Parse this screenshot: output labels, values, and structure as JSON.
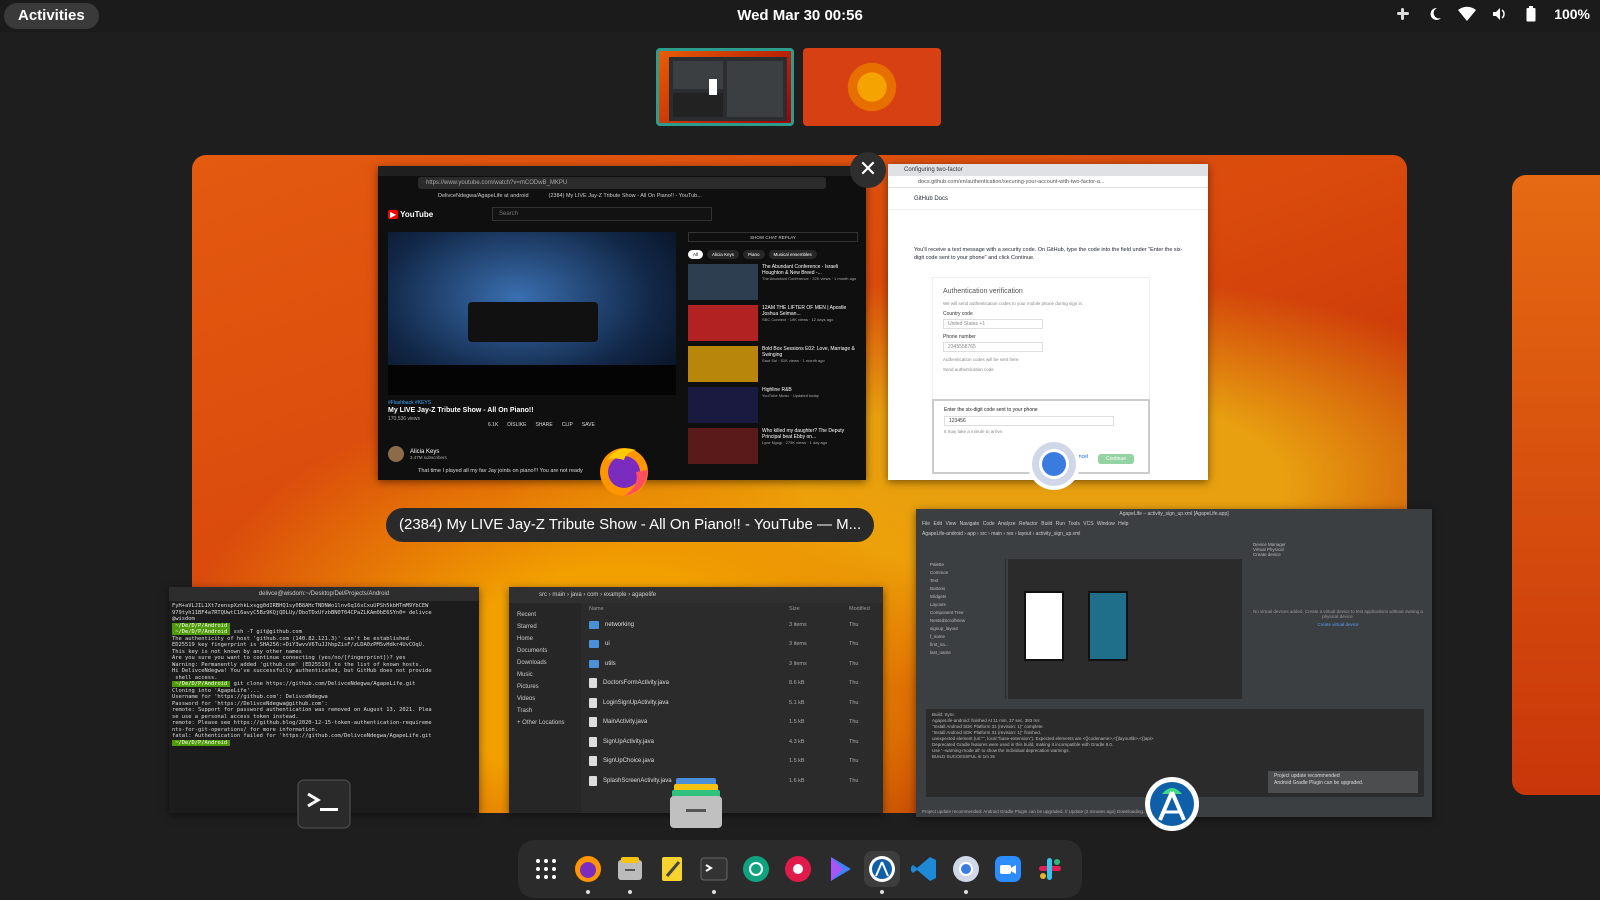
{
  "topbar": {
    "activities": "Activities",
    "clock": "Wed Mar 30  00:56",
    "battery": "100%"
  },
  "overview": {
    "focused_window_title": "(2384) My LIVE Jay-Z Tribute Show - All On Piano!! - YouTube — M...",
    "close_symbol": "✕"
  },
  "youtube": {
    "url": "https://www.youtube.com/watch?v=mCODwB_MKPU",
    "tab1": "DelivceNdegwa/AgapeLife at android",
    "tab2": "(2384) My LIVE Jay-Z Tribute Show - All On Piano!! - YouTub...",
    "logo": "YouTube",
    "search_placeholder": "Search",
    "hashtags": "#Flashback #KEYS",
    "video_title": "My LIVE Jay-Z Tribute Show - All On Piano!!",
    "views": "170,536 views",
    "actions": [
      "6.1K",
      "DISLIKE",
      "SHARE",
      "CLIP",
      "SAVE"
    ],
    "channel": "Alicia Keys",
    "subscribers": "3.47M subscribers",
    "description": "That time I played all my fav Jay joints on piano!!! You are not ready",
    "live_chat": "SHOW CHAT REPLAY",
    "chips": [
      "All",
      "Alicia Keys",
      "Piano",
      "Musical ensembles"
    ],
    "recs": [
      {
        "title": "The Abundant Conference - Israeli Houghton & New Breed -...",
        "sub": "The Abundant Conference · 22K views · 1 month ago",
        "color": "#2c3e50"
      },
      {
        "title": "12AM THE LIFTER OF MEN | Apostle Joshua Selman...",
        "sub": "SBC Connect · 19K views · 12 days ago",
        "color": "#b22222"
      },
      {
        "title": "Bold Box Sessions E02: Love, Marriage & Swinging",
        "sub": "Saut Sol · 51K views · 1 month ago",
        "color": "#b8860b"
      },
      {
        "title": "Highline R&B",
        "sub": "YouTube Music · Updated today",
        "color": "#1a1a40"
      },
      {
        "title": "Who killed my daughter? The Deputy Principal beat Ebby on...",
        "sub": "Lyne Ngugi · 279K views · 1 day ago",
        "color": "#5a1a1a"
      }
    ]
  },
  "github": {
    "tab": "Configuring two-factor",
    "url": "docs.github.com/en/authentication/securing-your-account-with-two-factor-a...",
    "brand": "GitHub Docs",
    "step_text": "You'll receive a text message with a security code. On GitHub, type the code into the field under \"Enter the six-digit code sent to your phone\" and click Continue.",
    "auth_title": "Authentication verification",
    "auth_desc": "We will send authentication codes to your mobile phone during sign in.",
    "country_label": "Country code",
    "country_value": "United States +1",
    "phone_label": "Phone number",
    "phone_value": "2345558765",
    "phone_hint": "Authentication codes will be sent here.",
    "send_button": "Send authentication code",
    "code_label": "Enter the six-digit code sent to your phone",
    "code_value": "123456",
    "code_hint": "It may take a minute to arrive.",
    "cancel": "Cancel",
    "continue": "Continue"
  },
  "terminal": {
    "title": "delivce@wisdom:~/Desktop/Del/Projects/Android",
    "lines": [
      "FyH+aVLJIL1Xt7zenspXzhkLxsgg0dIRBHQ1sy0B8AHcTNDNWo1lnv6q16xCxuUPSh5kbHTmM9YbCEW",
      "979tyh11BF4a7RTQUwtC16avyC5Bz9KQjQDLUy/DboTDxUfzbBN0T04CPaZLKAm0bE6SYn0= delivce",
      "@wisdom",
      " ~/De/D/P/Android ",
      " ~/De/D/P/Android  ssh -T git@github.com",
      "The authenticity of host 'github.com (140.82.121.3)' can't be established.",
      "ED25519 key fingerprint is SHA256:+DiY3wvvV6TuJJhbpZisF/zLDA0zPMSvHdkr4UvCOqU.",
      "This key is not known by any other names",
      "Are you sure you want to continue connecting (yes/no/[fingerprint])? yes",
      "Warning: Permanently added 'github.com' (ED25519) to the list of known hosts.",
      "Hi DelivceNdegwa! You've successfully authenticated, but GitHub does not provide",
      " shell access.",
      " ~/De/D/P/Android  git clone https://github.com/DelivceNdegwa/AgapeLife.git",
      "Cloning into 'AgapeLife'...",
      "Username for 'https://github.com': DelivceNdegwa",
      "Password for 'https://DelivceNdegwa@github.com':",
      "remote: Support for password authentication was removed on August 13, 2021. Plea",
      "se use a personal access token instead.",
      "remote: Please see https://github.blog/2020-12-15-token-authentication-requireme",
      "nts-for-git-operations/ for more information.",
      "fatal: Authentication failed for 'https://github.com/DelivceNdegwa/AgapeLife.git",
      " ~/De/D/P/Android  "
    ]
  },
  "files": {
    "path": [
      "src",
      "main",
      "java",
      "com",
      "example",
      "agapelife"
    ],
    "sidebar": [
      "Recent",
      "Starred",
      "Home",
      "Documents",
      "Downloads",
      "Music",
      "Pictures",
      "Videos",
      "Trash",
      "+ Other Locations"
    ],
    "headers": {
      "name": "Name",
      "size": "Size",
      "modified": "Modified"
    },
    "rows": [
      {
        "name": "networking",
        "size": "3 items",
        "modified": "Thu",
        "folder": true
      },
      {
        "name": "ui",
        "size": "3 items",
        "modified": "Thu",
        "folder": true
      },
      {
        "name": "utils",
        "size": "3 items",
        "modified": "Thu",
        "folder": true
      },
      {
        "name": "DoctorsFormActivity.java",
        "size": "8.6 kB",
        "modified": "Thu",
        "folder": false
      },
      {
        "name": "LoginSignUpActivity.java",
        "size": "5.1 kB",
        "modified": "Thu",
        "folder": false
      },
      {
        "name": "MainActivity.java",
        "size": "1.5 kB",
        "modified": "Thu",
        "folder": false
      },
      {
        "name": "SignUpActivity.java",
        "size": "4.3 kB",
        "modified": "Thu",
        "folder": false
      },
      {
        "name": "SignUpChoice.java",
        "size": "1.5 kB",
        "modified": "Thu",
        "folder": false
      },
      {
        "name": "SplashScreenActivity.java",
        "size": "1.6 kB",
        "modified": "Thu",
        "folder": false
      }
    ]
  },
  "android_studio": {
    "title": "AgapeLife – activity_sign_up.xml [AgapeLife.app]",
    "menu": "File Edit View Navigate Code Analyze Refactor Build Run Tools VCS Window Help",
    "crumbs": "AgapeLife-android › app › src › main › res › layout › activity_sign_up.xml",
    "palette": [
      "Palette",
      "Common",
      "Text",
      "Buttons",
      "Widgets",
      "Layouts",
      "Component Tree",
      "NestedScrollView",
      "signup_layout",
      "f_name",
      "first_na...",
      "last_name"
    ],
    "device_manager": "Device Manager",
    "dm_tabs": "Virtual   Physical",
    "dm_create": "Create device",
    "dm_msg": "No virtual devices added. Create a virtual device to test applications without owning a physical device.",
    "dm_link": "Create virtual device",
    "build_lines": [
      "Build:  Sync",
      "AgapeLife-android: finished  At 11 min, 37 sec, 383 ms",
      "\"Install Android SDK Platform 31 (revision: 1)\" complete.",
      "\"Install Android SDK Platform 31 (revision: 1)\" finished.",
      "unexpected element (uri:\"\", local:\"base-extension\"). Expected elements are <{}codename>,<{}layoutlib>,<{}api>",
      "Deprecated Gradle features were used in this build, making it incompatible with Gradle 8.0.",
      "Use '--warning-mode all' to show the individual deprecation warnings.",
      "BUILD SUCCESSFUL in 1m 3s"
    ],
    "notif_title": "Project update recommended",
    "notif_body": "Android Gradle Plugin can be upgraded.",
    "status": "Project update recommended: Android Gradle Plugin can be upgraded. // Update (2 minutes ago)    Downloading..."
  },
  "dock": {
    "items": [
      {
        "name": "show-apps",
        "running": false,
        "active": false
      },
      {
        "name": "firefox",
        "running": true,
        "active": false
      },
      {
        "name": "files",
        "running": true,
        "active": false
      },
      {
        "name": "text-editor",
        "running": false,
        "active": false
      },
      {
        "name": "terminal",
        "running": true,
        "active": false
      },
      {
        "name": "chatgpt-style-app",
        "running": false,
        "active": false
      },
      {
        "name": "flower-app",
        "running": false,
        "active": false
      },
      {
        "name": "play-store",
        "running": false,
        "active": false
      },
      {
        "name": "android-studio",
        "running": true,
        "active": true
      },
      {
        "name": "vscode",
        "running": false,
        "active": false
      },
      {
        "name": "chrome",
        "running": true,
        "active": false
      },
      {
        "name": "zoom",
        "running": false,
        "active": false
      },
      {
        "name": "slack",
        "running": false,
        "active": false
      }
    ]
  }
}
